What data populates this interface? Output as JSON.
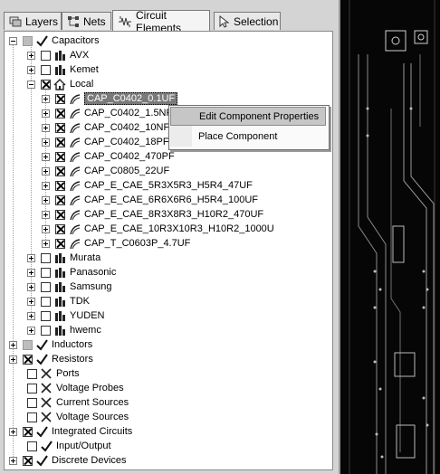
{
  "tabs": [
    {
      "label": "Layers",
      "icon": "layers-icon"
    },
    {
      "label": "Nets",
      "icon": "nets-icon"
    },
    {
      "label": "Circuit Elements",
      "icon": "circuit-elements-icon",
      "active": true
    },
    {
      "label": "Selection",
      "icon": "cursor-icon"
    }
  ],
  "tree": {
    "capacitors": "Capacitors",
    "vendors_top": [
      "AVX",
      "Kemet"
    ],
    "local": "Local",
    "local_items": [
      "CAP_C0402_0.1UF",
      "CAP_C0402_1.5NF",
      "CAP_C0402_10NF",
      "CAP_C0402_18PF",
      "CAP_C0402_470PF",
      "CAP_C0805_22UF",
      "CAP_E_CAE_5R3X5R3_H5R4_47UF",
      "CAP_E_CAE_6R6X6R6_H5R4_100UF",
      "CAP_E_CAE_8R3X8R3_H10R2_470UF",
      "CAP_E_CAE_10R3X10R3_H10R2_1000U",
      "CAP_T_C0603P_4.7UF"
    ],
    "vendors_bottom": [
      "Murata",
      "Panasonic",
      "Samsung",
      "TDK",
      "YUDEN",
      "hwemc"
    ],
    "categories": [
      {
        "label": "Inductors",
        "checkbox": "grey",
        "mark": "check",
        "expandable": true
      },
      {
        "label": "Resistors",
        "checkbox": "x",
        "mark": "check",
        "expandable": true
      },
      {
        "label": "Ports",
        "checkbox": "empty",
        "mark": "cross",
        "expandable": false
      },
      {
        "label": "Voltage Probes",
        "checkbox": "empty",
        "mark": "cross",
        "expandable": false
      },
      {
        "label": "Current Sources",
        "checkbox": "empty",
        "mark": "cross",
        "expandable": false
      },
      {
        "label": "Voltage Sources",
        "checkbox": "empty",
        "mark": "cross",
        "expandable": false
      },
      {
        "label": "Integrated Circuits",
        "checkbox": "x",
        "mark": "check",
        "expandable": true
      },
      {
        "label": "Input/Output",
        "checkbox": "empty",
        "mark": "check",
        "expandable": false
      },
      {
        "label": "Discrete Devices",
        "checkbox": "x",
        "mark": "check",
        "expandable": true
      }
    ]
  },
  "context_menu": {
    "edit": "Edit Component Properties",
    "place": "Place Component"
  },
  "colors": {
    "selection": "#7a7a7a",
    "menu_highlight": "#c6c6c6",
    "canvas": "#060606"
  }
}
